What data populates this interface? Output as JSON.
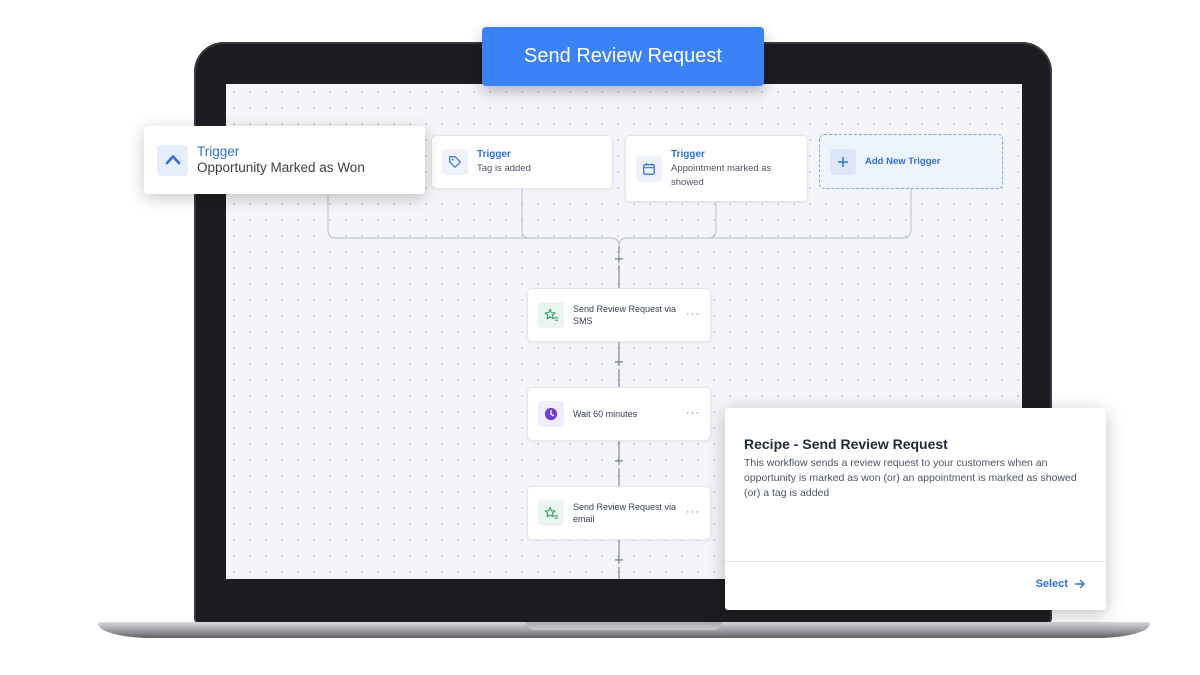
{
  "header": {
    "title": "Send Review Request"
  },
  "triggers": [
    {
      "label": "Trigger",
      "sub": "Opportunity Marked as Won",
      "icon": "chevron-up-icon"
    },
    {
      "label": "Trigger",
      "sub": "Tag is added",
      "icon": "tag-icon"
    },
    {
      "label": "Trigger",
      "sub": "Appointment marked as showed",
      "icon": "calendar-icon"
    }
  ],
  "add_trigger": {
    "label": "Add New Trigger",
    "icon": "plus-icon"
  },
  "actions": [
    {
      "label": "Send Review Request via SMS",
      "icon": "star-list-icon"
    },
    {
      "label": "Wait 60 minutes",
      "icon": "clock-icon"
    },
    {
      "label": "Send Review Request via email",
      "icon": "star-list-icon"
    }
  ],
  "more_menu": "···",
  "add_step": "+",
  "recipe": {
    "title": "Recipe - Send Review Request",
    "description": "This workflow sends a review request to your customers when an opportunity is marked as won (or) an appointment is marked as showed (or) a tag is added",
    "select_label": "Select"
  },
  "colors": {
    "accent": "#3b82f6",
    "link": "#2f6fd6",
    "wait_icon": "#6d3fd1",
    "review_icon": "#2f9a5a"
  }
}
